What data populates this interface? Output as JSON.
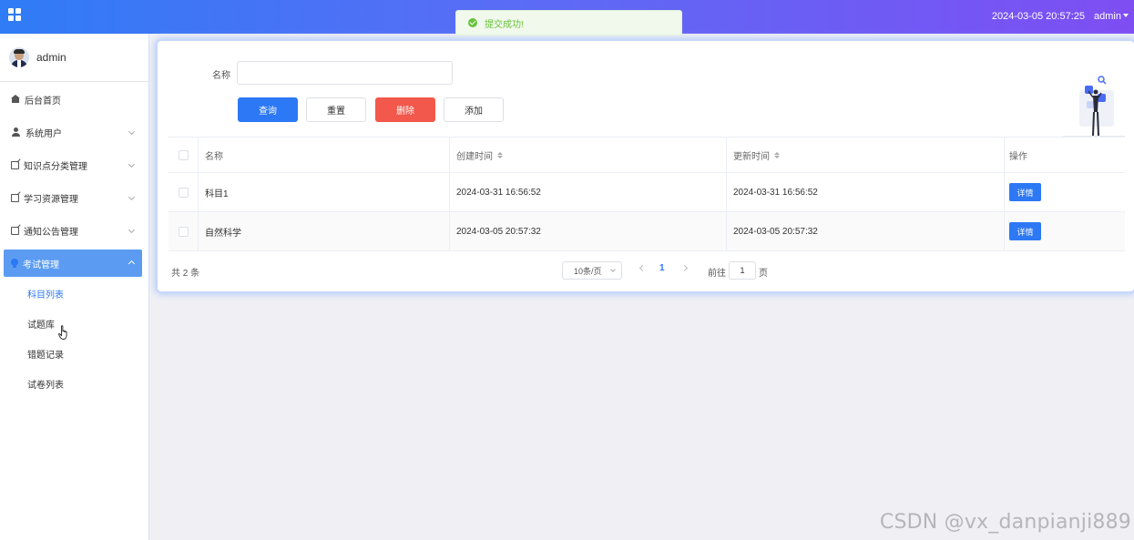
{
  "header": {
    "datetime": "2024-03-05 20:57:25",
    "user": "admin"
  },
  "toast": {
    "message": "提交成功!"
  },
  "sidebar": {
    "username": "admin",
    "items": [
      {
        "label": "后台首页",
        "icon": "home-icon"
      },
      {
        "label": "系统用户",
        "icon": "user-icon"
      },
      {
        "label": "知识点分类管理",
        "icon": "edit-icon"
      },
      {
        "label": "学习资源管理",
        "icon": "edit-icon"
      },
      {
        "label": "通知公告管理",
        "icon": "edit-icon"
      },
      {
        "label": "考试管理",
        "icon": "bulb-icon"
      }
    ],
    "subitems": [
      {
        "label": "科目列表"
      },
      {
        "label": "试题库"
      },
      {
        "label": "错题记录"
      },
      {
        "label": "试卷列表"
      }
    ]
  },
  "search": {
    "label": "名称",
    "value": "",
    "query_label": "查询",
    "reset_label": "重置",
    "delete_label": "删除",
    "add_label": "添加"
  },
  "table": {
    "headers": [
      "名称",
      "创建时间",
      "更新时间",
      "操作"
    ],
    "rows": [
      {
        "name": "科目1",
        "created": "2024-03-31 16:56:52",
        "updated": "2024-03-31 16:56:52",
        "action": "详情"
      },
      {
        "name": "自然科学",
        "created": "2024-03-05 20:57:32",
        "updated": "2024-03-05 20:57:32",
        "action": "详情"
      }
    ]
  },
  "pagination": {
    "total": "共 2 条",
    "page_size": "10条/页",
    "current_page": "1",
    "goto_label": "前往",
    "goto_value": "1",
    "page_unit": "页"
  },
  "watermark": "CSDN @vx_danpianji889",
  "colors": {
    "primary": "#2d78f4",
    "danger": "#f2584b",
    "success": "#67c23a",
    "header_start": "#2f7cf6",
    "header_end": "#7e4ef3"
  }
}
